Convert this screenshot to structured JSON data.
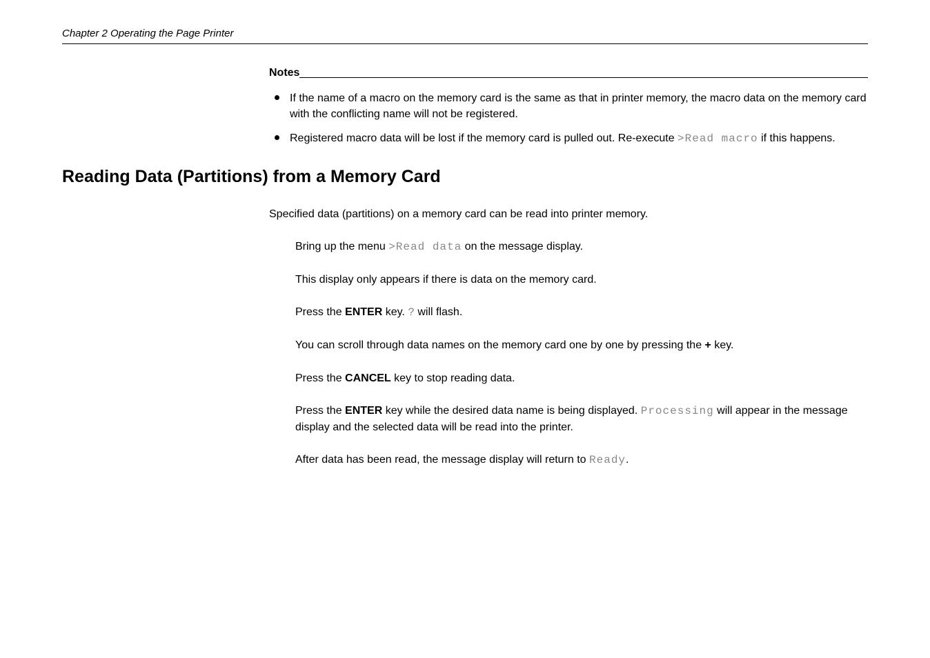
{
  "header": {
    "chapter_line": "Chapter 2  Operating the Page Printer"
  },
  "notes": {
    "label": "Notes",
    "items": [
      {
        "text_a": "If the name of a macro on the memory card is the same as that in printer memory, the macro data on the memory card with the conflicting name will not be registered."
      },
      {
        "text_a": "Registered macro data will be lost if the memory card is pulled out. Re-execute ",
        "code_a": ">Read macro",
        "text_b": " if this happens."
      }
    ]
  },
  "section": {
    "heading": "Reading Data (Partitions) from a Memory Card",
    "intro": "Specified data (partitions) on a memory card can be read into printer memory."
  },
  "steps": {
    "s1_a": "Bring up the menu ",
    "s1_code": ">Read data",
    "s1_b": " on the message display.",
    "s2": "This display only appears if there is data on the memory card.",
    "s3_a": "Press the ",
    "s3_bold": "ENTER",
    "s3_b": " key. ",
    "s3_q": "?",
    "s3_c": " will flash.",
    "s4_a": "You can scroll through data names on the memory card one by one by pressing the ",
    "s4_bold": "+",
    "s4_b": " key.",
    "s5_a": "Press the ",
    "s5_bold": "CANCEL",
    "s5_b": " key to stop reading data.",
    "s6_a": "Press the ",
    "s6_bold": "ENTER",
    "s6_b": " key while the desired data name is being displayed. ",
    "s6_code": "Processing",
    "s6_c": " will appear in the message display and the selected data will be read into the printer.",
    "s7_a": "After data has been read, the message display will return to ",
    "s7_code": "Ready",
    "s7_b": "."
  }
}
